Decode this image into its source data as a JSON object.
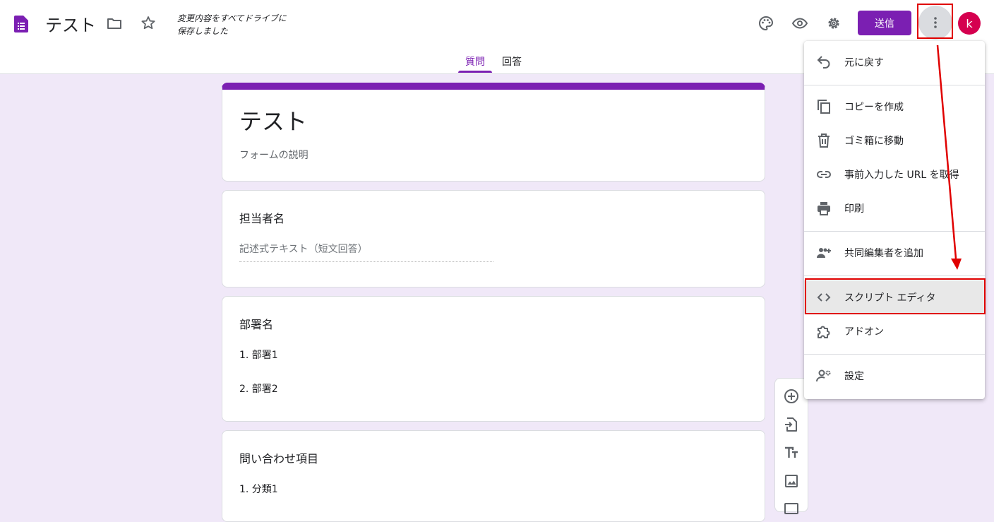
{
  "header": {
    "doc_title": "テスト",
    "save_status_line1": "変更内容をすべてドライブに",
    "save_status_line2": "保存しました",
    "send_label": "送信",
    "avatar_letter": "k"
  },
  "tabs": [
    {
      "label": "質問",
      "active": true
    },
    {
      "label": "回答",
      "active": false
    }
  ],
  "form": {
    "title": "テスト",
    "description": "フォームの説明",
    "questions": [
      {
        "title": "担当者名",
        "placeholder": "記述式テキスト（短文回答）"
      },
      {
        "title": "部署名",
        "options": [
          "1.  部署1",
          "2.  部署2"
        ]
      },
      {
        "title": "問い合わせ項目",
        "options": [
          "1.  分類1"
        ]
      }
    ]
  },
  "menu": {
    "items": [
      {
        "label": "元に戻す",
        "icon": "undo-icon"
      },
      {
        "label": "コピーを作成",
        "icon": "copy-icon"
      },
      {
        "label": "ゴミ箱に移動",
        "icon": "trash-icon"
      },
      {
        "label": "事前入力した URL を取得",
        "icon": "link-icon"
      },
      {
        "label": "印刷",
        "icon": "print-icon"
      },
      {
        "label": "共同編集者を追加",
        "icon": "add-people-icon"
      },
      {
        "label": "スクリプト エディタ",
        "icon": "code-icon",
        "highlighted": true
      },
      {
        "label": "アドオン",
        "icon": "puzzle-icon"
      },
      {
        "label": "設定",
        "icon": "settings-person-icon"
      }
    ]
  },
  "colors": {
    "accent": "#7b1fb2",
    "background": "#f0e8f8",
    "annotation_red": "#e00000"
  }
}
